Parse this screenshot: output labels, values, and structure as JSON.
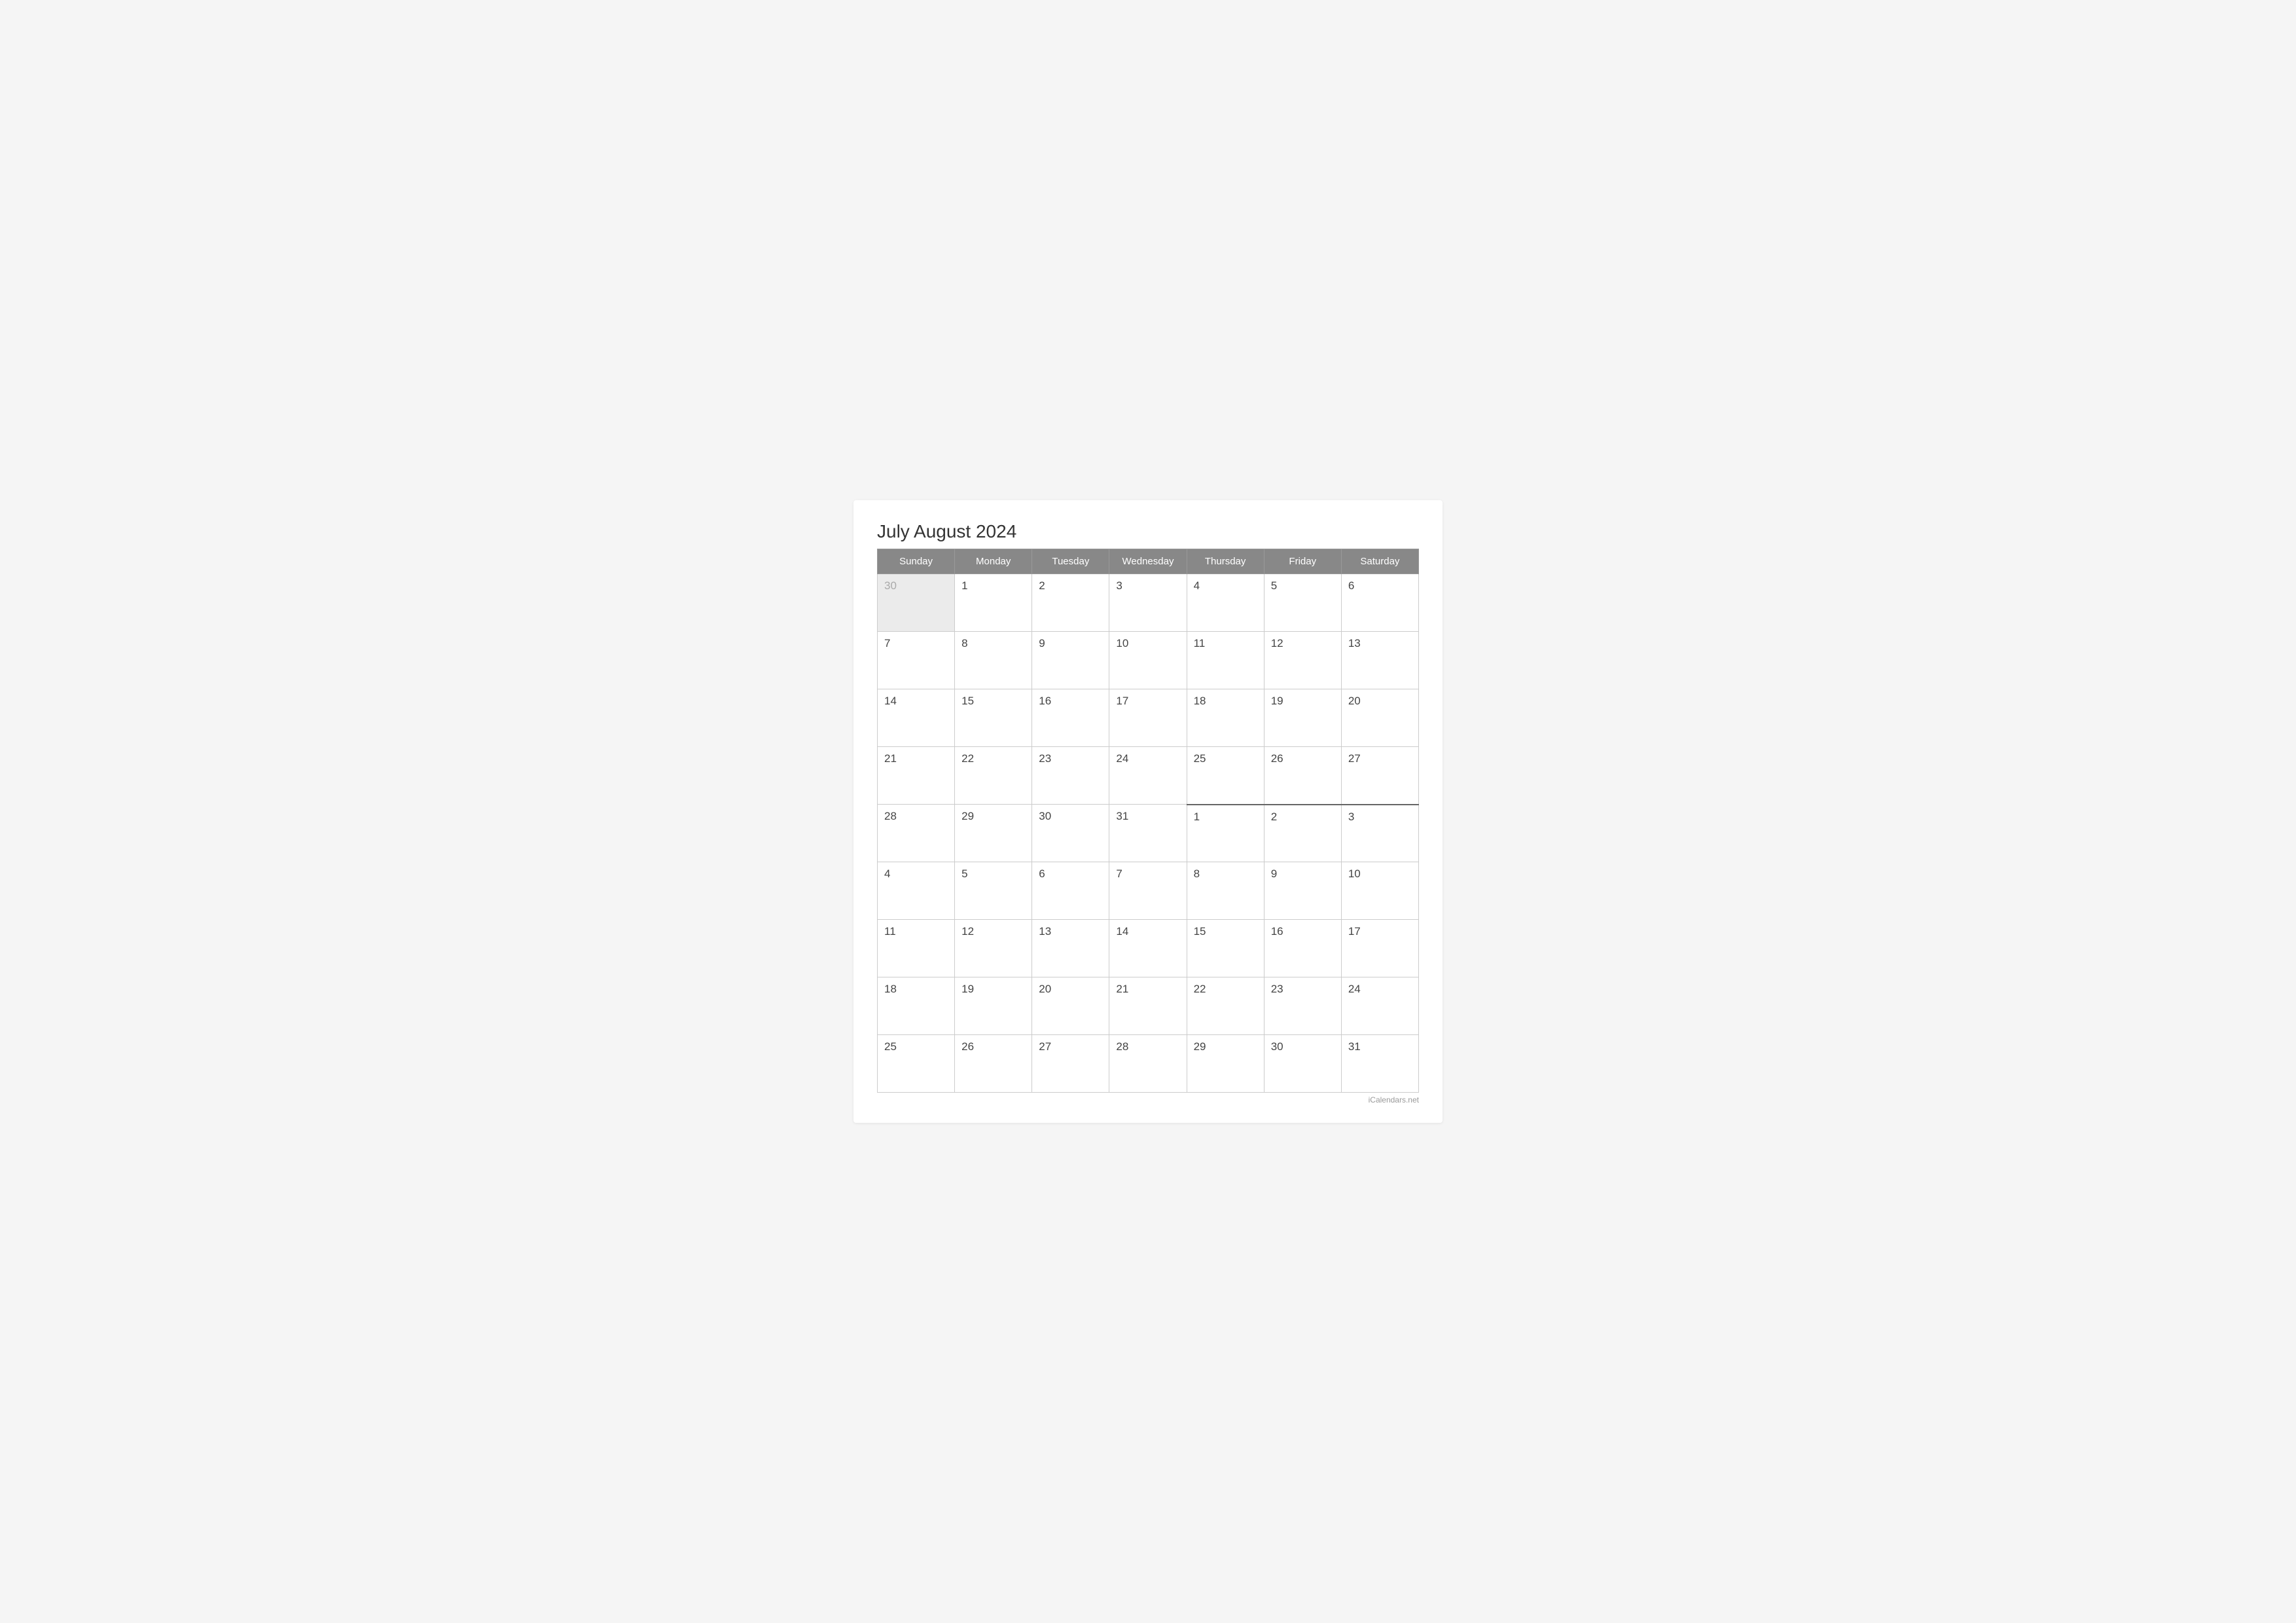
{
  "calendar": {
    "title": "July August 2024",
    "watermark": "iCalendars.net",
    "headers": [
      "Sunday",
      "Monday",
      "Tuesday",
      "Wednesday",
      "Thursday",
      "Friday",
      "Saturday"
    ],
    "rows": [
      [
        {
          "day": "30",
          "prevMonth": true
        },
        {
          "day": "1"
        },
        {
          "day": "2"
        },
        {
          "day": "3"
        },
        {
          "day": "4"
        },
        {
          "day": "5"
        },
        {
          "day": "6"
        }
      ],
      [
        {
          "day": "7"
        },
        {
          "day": "8"
        },
        {
          "day": "9"
        },
        {
          "day": "10"
        },
        {
          "day": "11"
        },
        {
          "day": "12"
        },
        {
          "day": "13"
        }
      ],
      [
        {
          "day": "14"
        },
        {
          "day": "15"
        },
        {
          "day": "16"
        },
        {
          "day": "17"
        },
        {
          "day": "18"
        },
        {
          "day": "19"
        },
        {
          "day": "20"
        }
      ],
      [
        {
          "day": "21"
        },
        {
          "day": "22"
        },
        {
          "day": "23"
        },
        {
          "day": "24"
        },
        {
          "day": "25"
        },
        {
          "day": "26"
        },
        {
          "day": "27"
        }
      ],
      [
        {
          "day": "28"
        },
        {
          "day": "29"
        },
        {
          "day": "30"
        },
        {
          "day": "31"
        },
        {
          "day": "1",
          "nextMonth": true,
          "divider": true
        },
        {
          "day": "2",
          "nextMonth": true,
          "divider": true
        },
        {
          "day": "3",
          "nextMonth": true,
          "divider": true
        }
      ],
      [
        {
          "day": "4"
        },
        {
          "day": "5"
        },
        {
          "day": "6"
        },
        {
          "day": "7"
        },
        {
          "day": "8"
        },
        {
          "day": "9"
        },
        {
          "day": "10"
        }
      ],
      [
        {
          "day": "11"
        },
        {
          "day": "12"
        },
        {
          "day": "13"
        },
        {
          "day": "14"
        },
        {
          "day": "15"
        },
        {
          "day": "16"
        },
        {
          "day": "17"
        }
      ],
      [
        {
          "day": "18"
        },
        {
          "day": "19"
        },
        {
          "day": "20"
        },
        {
          "day": "21"
        },
        {
          "day": "22"
        },
        {
          "day": "23"
        },
        {
          "day": "24"
        }
      ],
      [
        {
          "day": "25"
        },
        {
          "day": "26"
        },
        {
          "day": "27"
        },
        {
          "day": "28"
        },
        {
          "day": "29"
        },
        {
          "day": "30"
        },
        {
          "day": "31"
        }
      ]
    ]
  }
}
